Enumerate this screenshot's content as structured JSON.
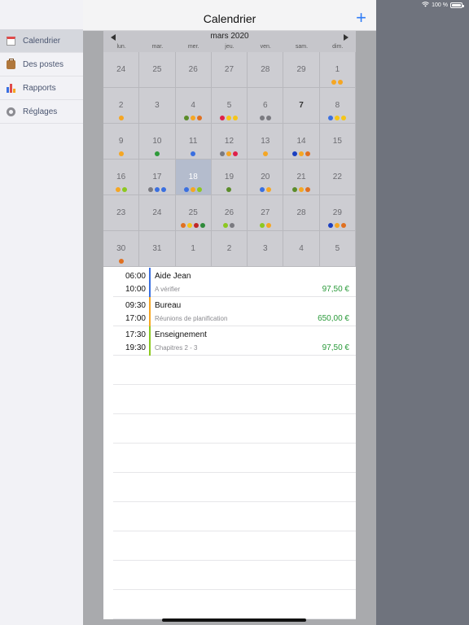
{
  "status": {
    "battery_text": "100 %"
  },
  "sidebar": {
    "items": [
      {
        "label": "Calendrier",
        "icon": "calendar-icon",
        "selected": true
      },
      {
        "label": "Des postes",
        "icon": "briefcase-icon",
        "selected": false
      },
      {
        "label": "Rapports",
        "icon": "bar-chart-icon",
        "selected": false
      },
      {
        "label": "Réglages",
        "icon": "gear-icon",
        "selected": false
      }
    ]
  },
  "navbar": {
    "title": "Calendrier",
    "add_label": "+"
  },
  "calendar": {
    "month_label": "mars 2020",
    "weekdays": [
      "lun.",
      "mar.",
      "mer.",
      "jeu.",
      "ven.",
      "sam.",
      "dim."
    ],
    "days": [
      {
        "n": "24",
        "dots": []
      },
      {
        "n": "25",
        "dots": []
      },
      {
        "n": "26",
        "dots": []
      },
      {
        "n": "27",
        "dots": []
      },
      {
        "n": "28",
        "dots": []
      },
      {
        "n": "29",
        "dots": []
      },
      {
        "n": "1",
        "dots": [
          "#f5a623",
          "#f5a623"
        ]
      },
      {
        "n": "2",
        "dots": [
          "#f5a623"
        ]
      },
      {
        "n": "3",
        "dots": []
      },
      {
        "n": "4",
        "dots": [
          "#5b8c2a",
          "#f5a623",
          "#e07020"
        ]
      },
      {
        "n": "5",
        "dots": [
          "#e0204a",
          "#f5c518",
          "#f5c518"
        ]
      },
      {
        "n": "6",
        "dots": [
          "#7a7a80",
          "#7a7a80"
        ]
      },
      {
        "n": "7",
        "dots": [],
        "today": true
      },
      {
        "n": "8",
        "dots": [
          "#3a6fe0",
          "#f5c518",
          "#f5c518"
        ]
      },
      {
        "n": "9",
        "dots": [
          "#f5a623"
        ]
      },
      {
        "n": "10",
        "dots": [
          "#2e9a3a"
        ]
      },
      {
        "n": "11",
        "dots": [
          "#3a6fe0"
        ]
      },
      {
        "n": "12",
        "dots": [
          "#7a7a80",
          "#f5a623",
          "#e0204a"
        ]
      },
      {
        "n": "13",
        "dots": [
          "#f5a623"
        ]
      },
      {
        "n": "14",
        "dots": [
          "#1a3fc0",
          "#f5a623",
          "#e07020"
        ]
      },
      {
        "n": "15",
        "dots": []
      },
      {
        "n": "16",
        "dots": [
          "#f5a623",
          "#8cc820"
        ]
      },
      {
        "n": "17",
        "dots": [
          "#7a7a80",
          "#3a6fe0",
          "#3a6fe0"
        ]
      },
      {
        "n": "18",
        "dots": [
          "#3a6fe0",
          "#f5a623",
          "#8cc820"
        ],
        "selected": true
      },
      {
        "n": "19",
        "dots": [
          "#5b8c2a"
        ]
      },
      {
        "n": "20",
        "dots": [
          "#3a6fe0",
          "#f5a623"
        ]
      },
      {
        "n": "21",
        "dots": [
          "#5b8c2a",
          "#f5a623",
          "#e07020"
        ]
      },
      {
        "n": "22",
        "dots": []
      },
      {
        "n": "23",
        "dots": []
      },
      {
        "n": "24",
        "dots": []
      },
      {
        "n": "25",
        "dots": [
          "#e07020",
          "#f5c518",
          "#c02828",
          "#2e8a3a"
        ]
      },
      {
        "n": "26",
        "dots": [
          "#8cc820",
          "#7a7a80"
        ]
      },
      {
        "n": "27",
        "dots": [
          "#8cc820",
          "#f5a623"
        ]
      },
      {
        "n": "28",
        "dots": []
      },
      {
        "n": "29",
        "dots": [
          "#1a3fc0",
          "#f5a623",
          "#e07020"
        ]
      },
      {
        "n": "30",
        "dots": [
          "#e07020"
        ]
      },
      {
        "n": "31",
        "dots": []
      },
      {
        "n": "1",
        "dots": []
      },
      {
        "n": "2",
        "dots": []
      },
      {
        "n": "3",
        "dots": []
      },
      {
        "n": "4",
        "dots": []
      },
      {
        "n": "5",
        "dots": []
      }
    ]
  },
  "events": [
    {
      "start": "06:00",
      "end": "10:00",
      "title": "Aide Jean",
      "subtitle": "A vérifier",
      "amount": "97,50 €",
      "color": "#3a6fe0"
    },
    {
      "start": "09:30",
      "end": "17:00",
      "title": "Bureau",
      "subtitle": "Réunions de planification",
      "amount": "650,00 €",
      "color": "#f5a623"
    },
    {
      "start": "17:30",
      "end": "19:30",
      "title": "Enseignement",
      "subtitle": "Chapitres 2 - 3",
      "amount": "97,50 €",
      "color": "#8cc820"
    }
  ]
}
